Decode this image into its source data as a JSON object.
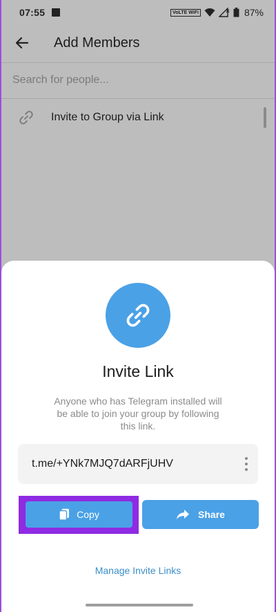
{
  "status_bar": {
    "time": "07:55",
    "volte": "VoLTE WiFi",
    "battery": "87%"
  },
  "app_bar": {
    "title": "Add Members"
  },
  "search": {
    "placeholder": "Search for people..."
  },
  "invite_row": {
    "label": "Invite to Group via Link",
    "icon": "link-icon"
  },
  "sheet": {
    "icon": "link-icon",
    "title": "Invite Link",
    "description": "Anyone who has Telegram installed will be able to join your group by following this link.",
    "link": "t.me/+YNk7MJQ7dARFjUHV",
    "copy_label": "Copy",
    "share_label": "Share",
    "manage_label": "Manage Invite Links"
  },
  "colors": {
    "accent": "#4aa1e6",
    "highlight": "#8e2be3",
    "link_text": "#3b8ec9",
    "dim_background": "#bdbdbd"
  }
}
